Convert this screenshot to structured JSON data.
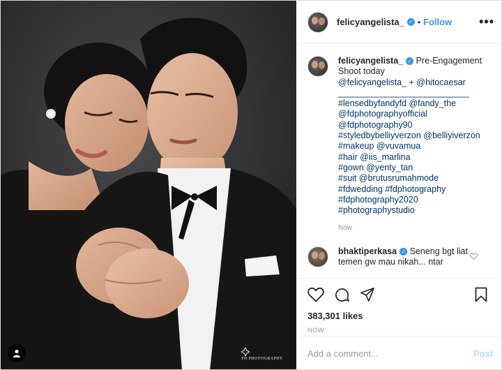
{
  "post": {
    "username": "felicyangelista_",
    "follow_label": "Follow",
    "more_label": "•••",
    "caption_lines": [
      "Pre-Engagement",
      "Shoot today",
      "@felicyangelista_ + @hitocaesar",
      "___________________________",
      "#lensedbyfandyfd @fandy_the",
      "@fdphotographyofficial",
      "@fdphotography90",
      "#styledbybelliyverzon @belliyiverzon",
      "#makeup @vuvamua",
      "#hair @iis_marlina",
      "#gown @yenty_tan",
      "#suit @brutusrumahmode",
      "#fdwedding #fdphotography",
      "#fdphotography2020",
      "#photographystudio"
    ],
    "caption_time": "Now",
    "likes": "383,301 likes",
    "time": "NOW"
  },
  "comment": {
    "username": "bhaktiperkasa",
    "text_line1": "Seneng bgt liat",
    "text_line2": "temen gw mau nikah... ntar"
  },
  "add_comment": {
    "placeholder": "Add a comment...",
    "post_label": "Post"
  },
  "photo": {
    "watermark": "FD PHOTOGRAPHY"
  },
  "colors": {
    "link": "#003569",
    "accent": "#3897f0",
    "muted": "#999999"
  }
}
